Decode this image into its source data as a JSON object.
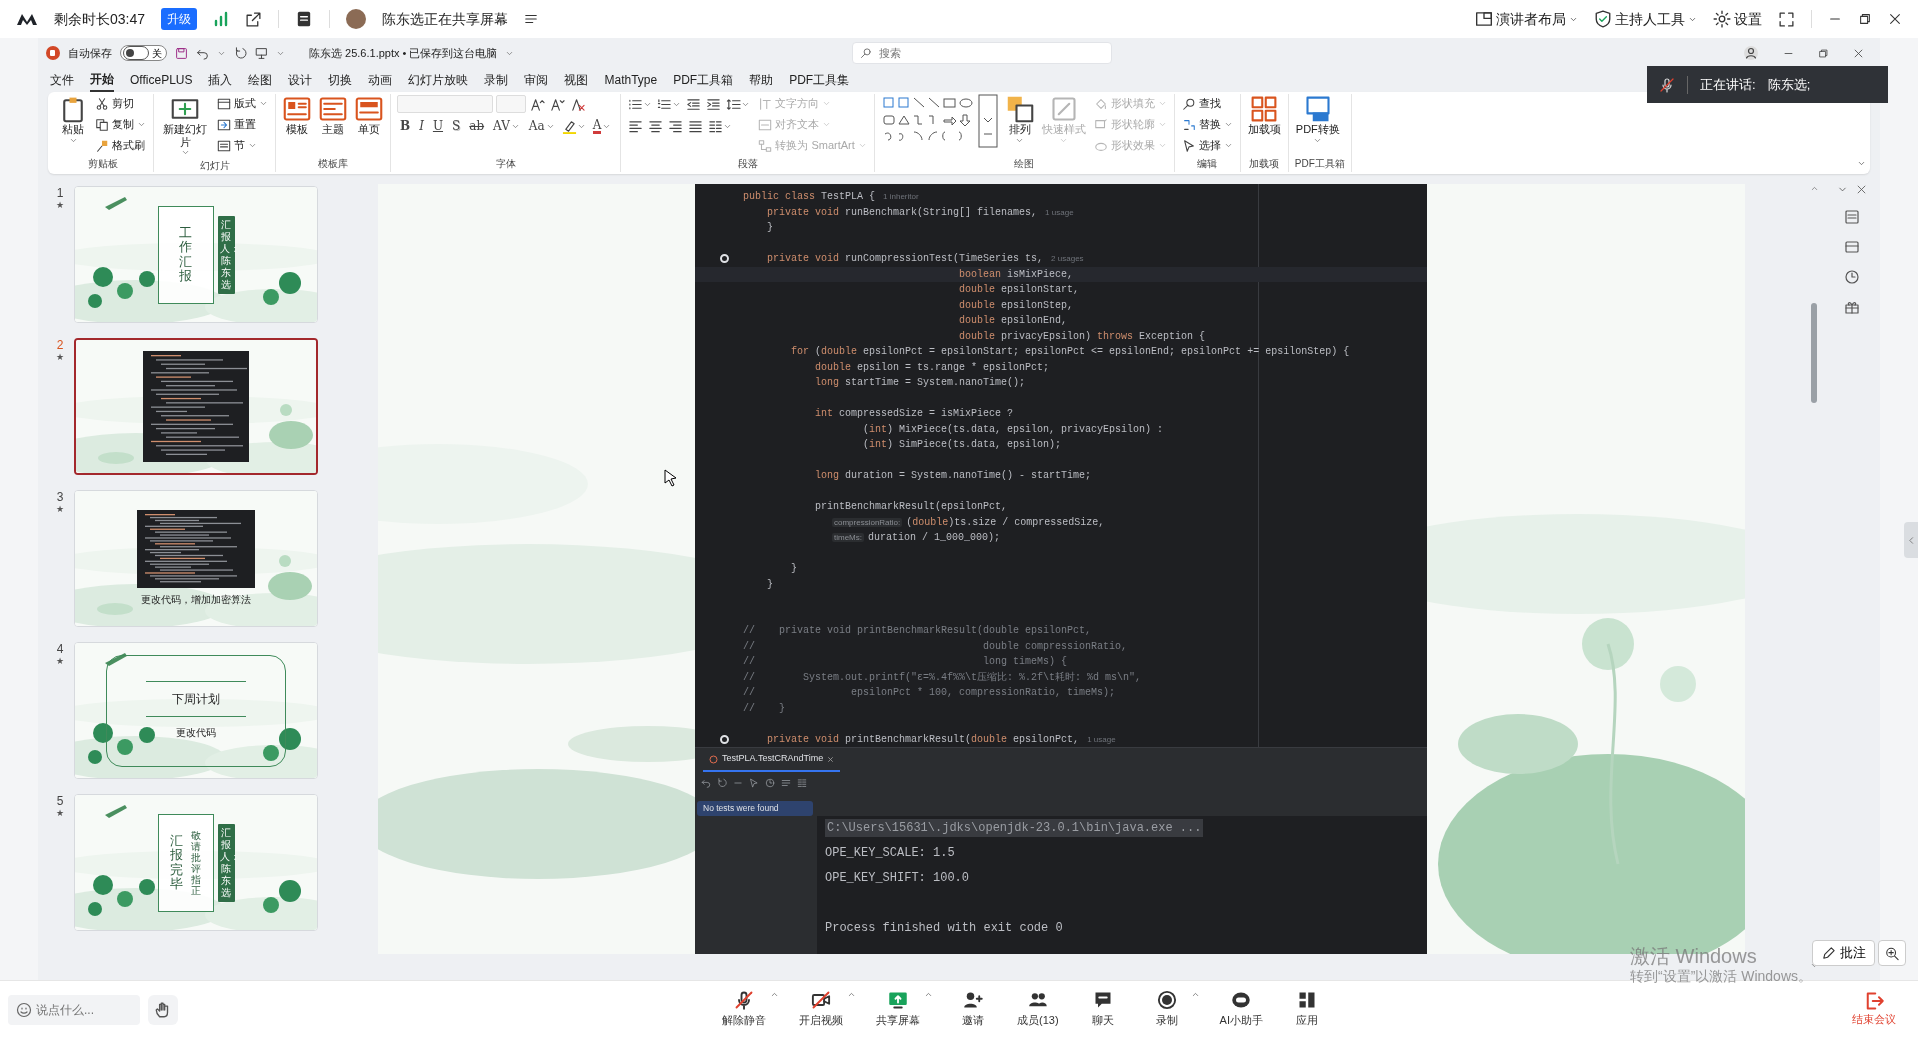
{
  "meeting_bar": {
    "time_left": "剩余时长03:47",
    "upgrade": "升级",
    "sharer": "陈东选正在共享屏幕",
    "right": [
      {
        "label": "演讲者布局",
        "caret": true
      },
      {
        "label": "主持人工具",
        "caret": true
      },
      {
        "label": "设置",
        "caret": false
      }
    ]
  },
  "ppt": {
    "autosave_label": "自动保存",
    "autosave": {
      "on": false,
      "text": "关"
    },
    "file_title": "陈东选 25.6.1.pptx • 已保存到这台电脑",
    "search": {
      "placeholder": "搜索"
    },
    "tabs": [
      {
        "label": "文件",
        "selected": false
      },
      {
        "label": "开始",
        "selected": true
      },
      {
        "label": "OfficePLUS",
        "selected": false
      },
      {
        "label": "插入",
        "selected": false
      },
      {
        "label": "绘图",
        "selected": false
      },
      {
        "label": "设计",
        "selected": false
      },
      {
        "label": "切换",
        "selected": false
      },
      {
        "label": "动画",
        "selected": false
      },
      {
        "label": "幻灯片放映",
        "selected": false
      },
      {
        "label": "录制",
        "selected": false
      },
      {
        "label": "审阅",
        "selected": false
      },
      {
        "label": "视图",
        "selected": false
      },
      {
        "label": "MathType",
        "selected": false
      },
      {
        "label": "PDF工具箱",
        "selected": false
      },
      {
        "label": "帮助",
        "selected": false
      },
      {
        "label": "PDF工具集",
        "selected": false
      }
    ],
    "ribbon": [
      {
        "label": "剪贴板",
        "columns": [
          [
            [
              {
                "kind": "large",
                "label": "粘贴",
                "caret": true
              }
            ]
          ],
          [
            [
              {
                "kind": "small",
                "label": "剪切"
              }
            ],
            [
              {
                "kind": "small",
                "label": "复制",
                "caret": true
              }
            ],
            [
              {
                "kind": "small",
                "label": "格式刷"
              }
            ]
          ]
        ]
      },
      {
        "label": "幻灯片",
        "columns": [
          [
            [
              {
                "kind": "large",
                "label": "新建幻灯片",
                "caret": true
              }
            ]
          ],
          [
            [
              {
                "kind": "small",
                "label": "版式",
                "caret": true
              }
            ],
            [
              {
                "kind": "small",
                "label": "重置"
              }
            ],
            [
              {
                "kind": "small",
                "label": "节",
                "caret": true
              }
            ]
          ]
        ]
      },
      {
        "label": "模板库",
        "columns": [
          [
            [
              {
                "kind": "large",
                "label": "模板"
              }
            ]
          ],
          [
            [
              {
                "kind": "large",
                "label": "主题"
              }
            ]
          ],
          [
            [
              {
                "kind": "large",
                "label": "单页"
              }
            ]
          ]
        ]
      },
      {
        "label": "字体",
        "columns": [
          [
            [
              {
                "kind": "field",
                "disabled": true
              },
              {
                "kind": "field",
                "disabled": true
              },
              {
                "kind": "icon"
              },
              {
                "kind": "icon"
              },
              {
                "kind": "icon"
              }
            ],
            [
              {
                "kind": "glyph",
                "label": "B"
              },
              {
                "kind": "glyph",
                "label": "I"
              },
              {
                "kind": "glyph",
                "label": "U"
              },
              {
                "kind": "glyph",
                "label": "S"
              },
              {
                "kind": "glyph",
                "label": "ab"
              },
              {
                "kind": "glyph",
                "label": "AV",
                "caret": true
              },
              {
                "kind": "glyph",
                "label": "Aa",
                "caret": true
              },
              {
                "kind": "icon",
                "caret": true
              },
              {
                "kind": "glyph",
                "label": "A",
                "caret": true
              }
            ]
          ]
        ]
      },
      {
        "label": "段落",
        "columns": [
          [
            [
              {
                "kind": "icon",
                "caret": true
              },
              {
                "kind": "icon",
                "caret": true
              },
              {
                "kind": "icon"
              },
              {
                "kind": "icon"
              },
              {
                "kind": "icon",
                "caret": true
              }
            ],
            [
              {
                "kind": "icon"
              },
              {
                "kind": "icon"
              },
              {
                "kind": "icon"
              },
              {
                "kind": "icon"
              },
              {
                "kind": "icon",
                "caret": true
              }
            ]
          ],
          [
            [
              {
                "kind": "small",
                "label": "文字方向",
                "caret": true,
                "disabled": true
              }
            ],
            [
              {
                "kind": "small",
                "label": "对齐文本",
                "caret": true,
                "disabled": true
              }
            ],
            [
              {
                "kind": "small",
                "label": "转换为 SmartArt",
                "caret": true,
                "disabled": true
              }
            ]
          ]
        ]
      },
      {
        "label": "绘图",
        "columns": [
          [
            [
              {
                "kind": "gallery"
              }
            ]
          ],
          [
            [
              {
                "kind": "large",
                "label": "排列",
                "caret": true
              }
            ]
          ],
          [
            [
              {
                "kind": "large",
                "label": "快速样式",
                "caret": true,
                "disabled": true
              }
            ]
          ],
          [
            [
              {
                "kind": "small",
                "label": "形状填充",
                "caret": true,
                "disabled": true
              }
            ],
            [
              {
                "kind": "small",
                "label": "形状轮廓",
                "caret": true,
                "disabled": true
              }
            ],
            [
              {
                "kind": "small",
                "label": "形状效果",
                "caret": true,
                "disabled": true
              }
            ]
          ]
        ]
      },
      {
        "label": "编辑",
        "columns": [
          [
            [
              {
                "kind": "small",
                "label": "查找"
              }
            ],
            [
              {
                "kind": "small",
                "label": "替换",
                "caret": true
              }
            ],
            [
              {
                "kind": "small",
                "label": "选择",
                "caret": true
              }
            ]
          ]
        ]
      },
      {
        "label": "加载项",
        "columns": [
          [
            [
              {
                "kind": "large",
                "label": "加载项"
              }
            ]
          ]
        ]
      },
      {
        "label": "PDF工具箱",
        "columns": [
          [
            [
              {
                "kind": "large",
                "label": "PDF转换",
                "caret": true
              }
            ]
          ]
        ]
      }
    ],
    "slides": [
      {
        "number": "1",
        "star": "★",
        "selected": false,
        "kind": "cover",
        "title": "工作汇报",
        "tag": "汇报人：陈东选"
      },
      {
        "number": "2",
        "star": "★",
        "selected": true,
        "kind": "code"
      },
      {
        "number": "3",
        "star": "★",
        "selected": false,
        "kind": "code",
        "caption": "更改代码，增加加密算法"
      },
      {
        "number": "4",
        "star": "★",
        "selected": false,
        "kind": "plan",
        "title": "下周计划",
        "subtitle": "更改代码"
      },
      {
        "number": "5",
        "star": "★",
        "selected": false,
        "kind": "cover",
        "title": "汇报完毕",
        "subtitle": "敬请批评指正",
        "tag": "汇报人：陈东选"
      }
    ],
    "editor": {
      "lines": [
        {
          "text": "public class TestPLA {",
          "hint": "1 inheritor"
        },
        {
          "text": "    private void runBenchmark(String[] filenames,",
          "hint": "1 usage"
        },
        {
          "text": "    }"
        },
        {
          "kind": "blank"
        },
        {
          "text": "    private void runCompressionTest(TimeSeries ts,",
          "hint": "2 usages",
          "marker": true
        },
        {
          "text": "                                    boolean isMixPiece,",
          "current": true
        },
        {
          "text": "                                    double epsilonStart,"
        },
        {
          "text": "                                    double epsilonStep,"
        },
        {
          "text": "                                    double epsilonEnd,"
        },
        {
          "text": "                                    double privacyEpsilon) throws Exception {"
        },
        {
          "text": "        for (double epsilonPct = epsilonStart; epsilonPct <= epsilonEnd; epsilonPct += epsilonStep) {"
        },
        {
          "text": "            double epsilon = ts.range * epsilonPct;"
        },
        {
          "text": "            long startTime = System.nanoTime();"
        },
        {
          "kind": "blank"
        },
        {
          "text": "            int compressedSize = isMixPiece ?"
        },
        {
          "text": "                    (int) MixPiece(ts.data, epsilon, privacyEpsilon) :"
        },
        {
          "text": "                    (int) SimPiece(ts.data, epsilon);"
        },
        {
          "kind": "blank"
        },
        {
          "text": "            long duration = System.nanoTime() - startTime;"
        },
        {
          "kind": "blank"
        },
        {
          "text": "            printBenchmarkResult(epsilonPct,"
        },
        {
          "inlay": "compressionRatio:",
          "text": "(double)ts.size / compressedSize,"
        },
        {
          "inlay": "timeMs:",
          "text": "duration / 1_000_000);"
        },
        {
          "kind": "blank"
        },
        {
          "text": "        }"
        },
        {
          "text": "    }"
        },
        {
          "kind": "blank"
        },
        {
          "kind": "blank"
        },
        {
          "text": "//    private void printBenchmarkResult(double epsilonPct,"
        },
        {
          "text": "//                                      double compressionRatio,"
        },
        {
          "text": "//                                      long timeMs) {"
        },
        {
          "text": "//        System.out.printf(\"ε=%.4f%%\\t压缩比: %.2f\\t耗时: %d ms\\n\","
        },
        {
          "text": "//                epsilonPct * 100, compressionRatio, timeMs);"
        },
        {
          "text": "//    }"
        },
        {
          "kind": "blank"
        },
        {
          "text": "    private void printBenchmarkResult(double epsilonPct,",
          "hint": "1 usage",
          "marker": true
        }
      ]
    },
    "run": {
      "tab": "TestPLA.TestCRAndTime",
      "tree_item": "No tests were found",
      "console": [
        {
          "kind": "command",
          "text": "C:\\Users\\15631\\.jdks\\openjdk-23.0.1\\bin\\java.exe ..."
        },
        {
          "kind": "output",
          "text": "OPE_KEY_SCALE: 1.5"
        },
        {
          "kind": "output",
          "text": "OPE_KEY_SHIFT: 100.0"
        },
        {
          "kind": "blank"
        },
        {
          "kind": "output",
          "text": "Process finished with exit code 0"
        }
      ]
    }
  },
  "speaking": {
    "label": "正在讲话:",
    "name": "陈东选;"
  },
  "annotate_button": "批注",
  "activation": {
    "title": "激活 Windows",
    "hint": "转到“设置”以激活 Windows。"
  },
  "toolbar": {
    "chat_placeholder": "说点什么...",
    "buttons": [
      {
        "label": "解除静音",
        "caret": true
      },
      {
        "label": "开启视频",
        "caret": true
      },
      {
        "label": "共享屏幕",
        "caret": true
      },
      {
        "label": "邀请",
        "caret": false
      },
      {
        "label": "成员(13)",
        "caret": false
      },
      {
        "label": "聊天",
        "caret": false
      },
      {
        "label": "录制",
        "caret": true
      },
      {
        "label": "AI小助手",
        "caret": false
      },
      {
        "label": "应用",
        "caret": false
      }
    ],
    "end": "结束会议"
  }
}
